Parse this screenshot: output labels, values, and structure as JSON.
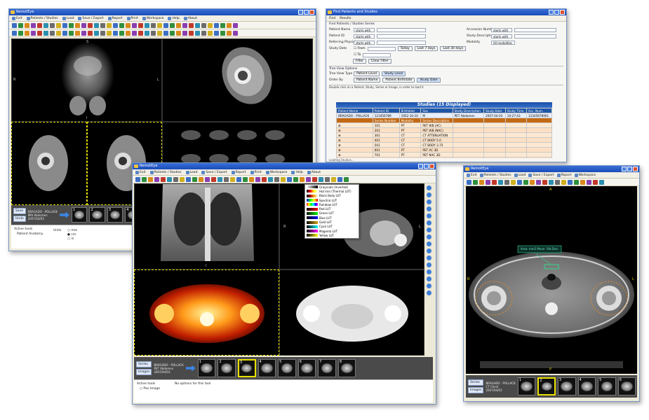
{
  "window_viewer_left": {
    "title": "RemotEye",
    "menu": [
      "Exit",
      "Patients / Studies",
      "Load",
      "Save / Export",
      "Report",
      "Print",
      "Workspace",
      "Help",
      "About"
    ],
    "info": {
      "name": "BRAGADO - POLLACK",
      "line2": "MRI Abdomen",
      "line3": "2007/04/03"
    },
    "side_buttons": [
      "Save",
      "Undo"
    ],
    "bottom": {
      "label_a": "Active tools",
      "label_b": "Patient Anatomy",
      "units_label": "Units",
      "radio_1": "mm",
      "radio_2": "cm",
      "radio_3": "in"
    },
    "thumbs": [
      "1",
      "2",
      "3",
      "4"
    ],
    "letters": {
      "top": "S",
      "left": "R",
      "right": "L",
      "bottom": "I"
    }
  },
  "window_query": {
    "title": "Find Patients and Studies",
    "tabs": [
      "Find",
      "Results"
    ],
    "section_filters": "Find Patients / Studies   Series",
    "fields": [
      {
        "label": "Patient Name",
        "value": "starts with"
      },
      {
        "label": "Patient ID",
        "value": "starts with"
      },
      {
        "label": "Referring Physician",
        "value": "starts with"
      },
      {
        "label": "Study Date",
        "value": ""
      }
    ],
    "right_fields": [
      {
        "label": "Accession Number",
        "value": "starts with"
      },
      {
        "label": "Study Description",
        "value": "starts with"
      },
      {
        "label": "Modality",
        "value": "All modalities"
      }
    ],
    "date_options": [
      "From",
      "To"
    ],
    "date_buttons": [
      "Today",
      "Last 7 days",
      "Last 30 days"
    ],
    "filter_buttons": [
      "Filter",
      "Clear Filter"
    ],
    "view_section": "Tree View Options",
    "view_rows": [
      {
        "label": "Tree View Type",
        "options": [
          "Patient Level",
          "Study Level"
        ]
      },
      {
        "label": "Order By",
        "options": [
          "Patient Name",
          "Patient Birthdate",
          "Study Date"
        ]
      }
    ],
    "results_note": "Double click on a Patient, Study, Series or Image, in order to load it",
    "table_title": "Studies (15 Displayed)",
    "study_headers": [
      "Patient Name",
      "Patient ID",
      "Birthdate",
      "Sex",
      "Study Description",
      "Study Date",
      "Study Time",
      "Acc. Num."
    ],
    "study_row": [
      "BRAGADO - POLLACK",
      "123456789",
      "1952-10-10",
      "M",
      "PET Abdomen",
      "2007-04-03",
      "10:27:43",
      "12345678901"
    ],
    "series_headers": [
      "Series Number",
      "Modality",
      "Series Description"
    ],
    "series_rows": [
      [
        "101",
        "PT",
        "PET WB (AC)"
      ],
      [
        "201",
        "PT",
        "PET WB (NAC)"
      ],
      [
        "301",
        "CT",
        "CT ATTENUATION"
      ],
      [
        "401",
        "CT",
        "CT BODY 5.0"
      ],
      [
        "501",
        "CT",
        "CT BODY 3.75"
      ],
      [
        "601",
        "PT",
        "PET AC 3D"
      ],
      [
        "701",
        "PT",
        "PET NAC 3D"
      ],
      [
        "801",
        "CT",
        "CT BODY 1.25"
      ],
      [
        "901",
        "CT",
        "CT CHEST 1.25"
      ],
      [
        "1001",
        "PT",
        "PET MIP"
      ],
      [
        "10000000",
        "SC",
        "Dose Report"
      ],
      [
        "10000001",
        "SC",
        "Patient Protocol"
      ]
    ],
    "footer": "Loading Studies..."
  },
  "window_viewer_front": {
    "title": "RemotEye",
    "menu": [
      "Exit",
      "Patients / Studies",
      "Load",
      "Save / Export",
      "Report",
      "Print",
      "Workspace",
      "Help",
      "About"
    ],
    "colormaps": [
      "Grayscale (Inverted)",
      "Hot Iron (Thermal LUT)",
      "Black Body LUT",
      "Spectral LUT",
      "Rainbow LUT",
      "Red LUT",
      "Green LUT",
      "Blue LUT",
      "Gold LUT",
      "Cyan LUT",
      "Magenta LUT",
      "Yellow LUT"
    ],
    "info": {
      "name": "BRAGADO - POLLACK",
      "line2": "PET Abdomen",
      "line3": "2007/04/03"
    },
    "side_buttons": [
      "Series",
      "Images"
    ],
    "thumbs": [
      "1",
      "2",
      "3",
      "4",
      "5",
      "6",
      "7",
      "8"
    ],
    "bottom": {
      "label_a": "Active tools",
      "label_b": "Pan Image",
      "hint": "No options for this tool"
    },
    "letters": {
      "top": "S",
      "left": "R",
      "right": "L",
      "bottom": "I"
    }
  },
  "window_viewer_right": {
    "title": "RemotEye",
    "menu": [
      "Exit",
      "Patients / Studies",
      "Load",
      "Save / Export",
      "Report",
      "Workspace"
    ],
    "annotation": "Area: mm2 Mean: Std.Dev:",
    "info": {
      "name": "BRAGADO - POLLACK",
      "line2": "CT Chest",
      "line3": "2007/04/03"
    },
    "side_buttons": [
      "Series",
      "Images"
    ],
    "thumbs": [
      "1",
      "2",
      "3",
      "4",
      "5",
      "6"
    ],
    "letters": {
      "top": "A",
      "left": "R",
      "right": "L",
      "bottom": "P"
    }
  },
  "colors": {
    "title_blue": "#1a4cb8",
    "accent_blue": "#3c86e6",
    "active_yellow": "#e8e000",
    "series_orange": "#c46a14",
    "roi_green": "#33d68a"
  },
  "icons": [
    "app-icon",
    "exit-icon",
    "folder-icon",
    "save-icon",
    "print-icon",
    "help-icon",
    "arrow-right-icon",
    "zoom-icon",
    "contrast-icon",
    "ruler-icon",
    "rotate-icon",
    "layout-icon"
  ]
}
